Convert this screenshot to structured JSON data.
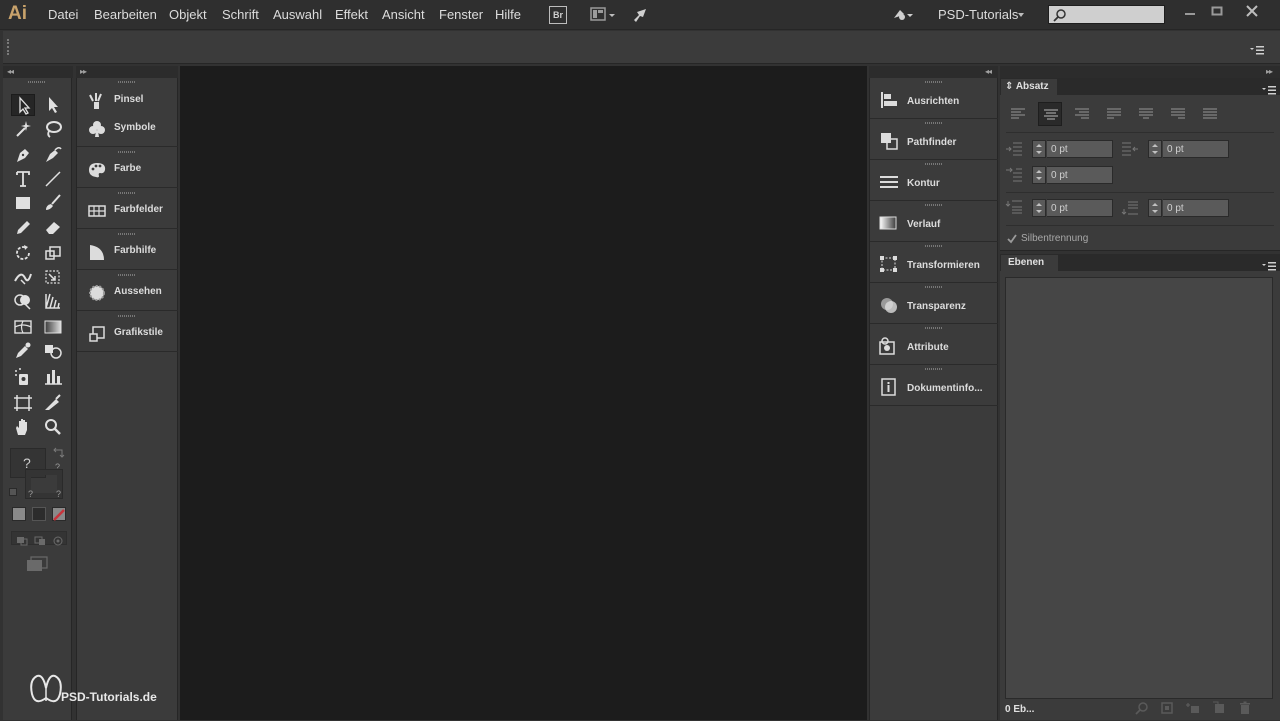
{
  "app": {
    "logo_text": "Ai",
    "menu": [
      "Datei",
      "Bearbeiten",
      "Objekt",
      "Schrift",
      "Auswahl",
      "Effekt",
      "Ansicht",
      "Fenster",
      "Hilfe"
    ],
    "bridge_label": "Br",
    "workspace": "PSD-Tutorials",
    "search_placeholder": ""
  },
  "left_panels": {
    "items": [
      "Pinsel",
      "Symbole",
      "Farbe",
      "Farbfelder",
      "Farbhilfe",
      "Aussehen",
      "Grafikstile"
    ]
  },
  "toolbox": {
    "question_marks": [
      "?",
      "?",
      "?",
      "?"
    ]
  },
  "right_panels": {
    "items": [
      "Ausrichten",
      "Pathfinder",
      "Kontur",
      "Verlauf",
      "Transformieren",
      "Transparenz",
      "Attribute",
      "Dokumentinfo..."
    ]
  },
  "absatz": {
    "tab": "Absatz",
    "fields": {
      "left_indent": "0 pt",
      "right_indent": "0 pt",
      "first_line_indent": "0 pt",
      "space_before": "0 pt",
      "space_after": "0 pt"
    },
    "hyphenation_label": "Silbentrennung",
    "hyphenation_checked": true
  },
  "ebenen": {
    "tab": "Ebenen",
    "count_label": "0 Eb..."
  },
  "watermark": "PSD-Tutorials.de",
  "colors": {
    "accent_logo": "#c8a26b",
    "canvas": "#1c1c1c",
    "panel": "#3b3b3b"
  }
}
